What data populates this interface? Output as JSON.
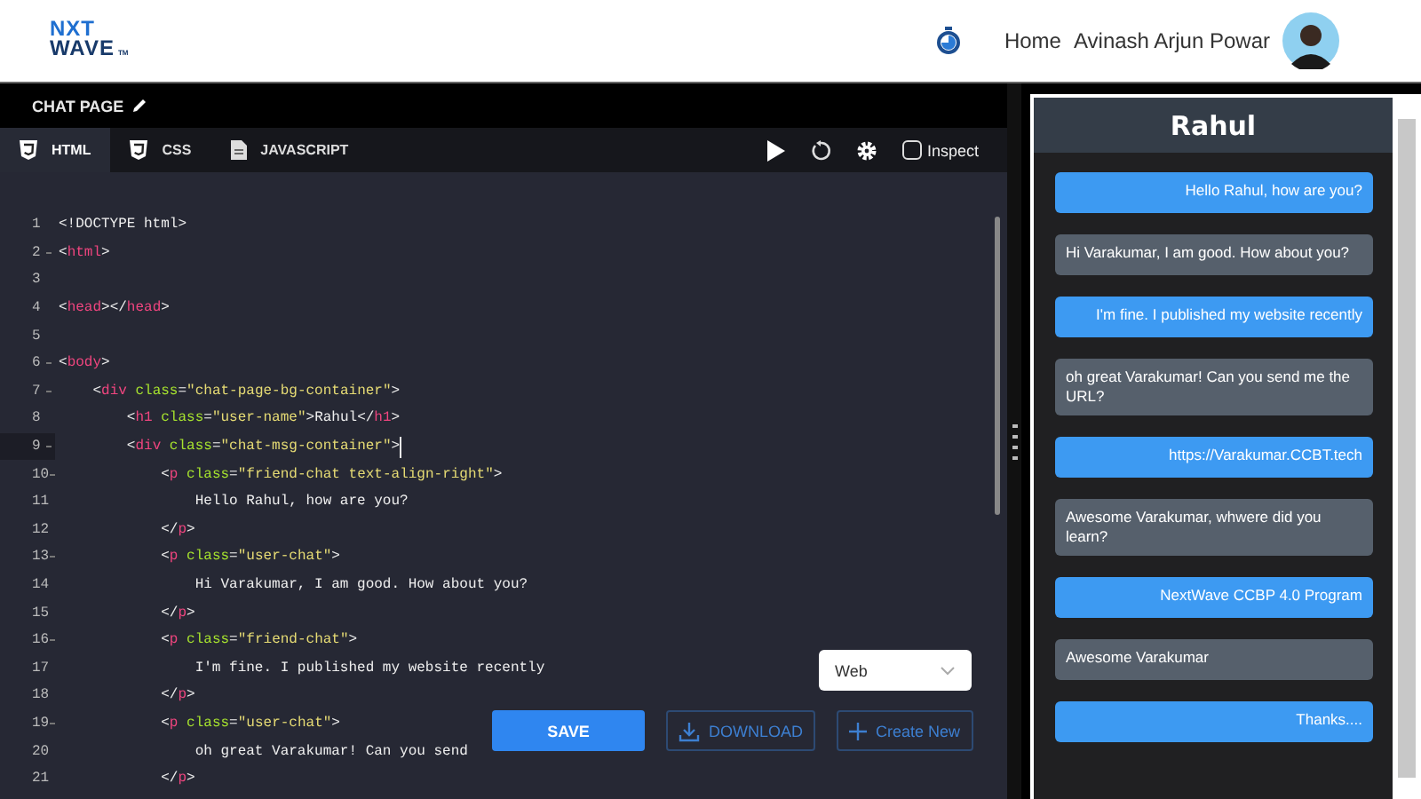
{
  "header": {
    "logo": {
      "line_1": "NXT",
      "line_2": "WAVE",
      "mark": "TM"
    },
    "nav": [
      {
        "label": "Home"
      }
    ],
    "user_name": "Avinash Arjun Powar"
  },
  "project": {
    "title": "CHAT PAGE"
  },
  "tabs": [
    {
      "label": "HTML",
      "kind": "html",
      "selected": true
    },
    {
      "label": "CSS",
      "kind": "css",
      "selected": false
    },
    {
      "label": "JAVASCRIPT",
      "kind": "js",
      "selected": false
    }
  ],
  "toolbar": {
    "inspect": {
      "label": "Inspect",
      "checked": false
    }
  },
  "editor": {
    "lines": [
      {
        "number": "1",
        "foldable": false,
        "active": false,
        "segments": [
          {
            "kind": "punct",
            "text": "<!DOCTYPE html>"
          }
        ]
      },
      {
        "number": "2",
        "foldable": true,
        "active": false,
        "segments": [
          {
            "kind": "punct",
            "text": "<"
          },
          {
            "kind": "tag",
            "text": "html"
          },
          {
            "kind": "punct",
            "text": ">"
          }
        ]
      },
      {
        "number": "3",
        "foldable": false,
        "active": false
      },
      {
        "number": "4",
        "foldable": false,
        "active": false,
        "segments": [
          {
            "kind": "punct",
            "text": "<"
          },
          {
            "kind": "tag",
            "text": "head"
          },
          {
            "kind": "punct",
            "text": "></"
          },
          {
            "kind": "tag",
            "text": "head"
          },
          {
            "kind": "punct",
            "text": ">"
          }
        ]
      },
      {
        "number": "5",
        "foldable": false,
        "active": false
      },
      {
        "number": "6",
        "foldable": true,
        "active": false,
        "segments": [
          {
            "kind": "punct",
            "text": "<"
          },
          {
            "kind": "tag",
            "text": "body"
          },
          {
            "kind": "punct",
            "text": ">"
          }
        ]
      },
      {
        "number": "7",
        "foldable": true,
        "active": false,
        "segments": [
          {
            "kind": "punct",
            "text": "    <"
          },
          {
            "kind": "tag",
            "text": "div"
          },
          {
            "kind": "attr",
            "text": " class"
          },
          {
            "kind": "punct",
            "text": "="
          },
          {
            "kind": "string",
            "text": "\"chat-page-bg-container\""
          },
          {
            "kind": "punct",
            "text": ">"
          }
        ]
      },
      {
        "number": "8",
        "foldable": false,
        "active": false,
        "segments": [
          {
            "kind": "punct",
            "text": "        <"
          },
          {
            "kind": "tag",
            "text": "h1"
          },
          {
            "kind": "attr",
            "text": " class"
          },
          {
            "kind": "punct",
            "text": "="
          },
          {
            "kind": "string",
            "text": "\"user-name\""
          },
          {
            "kind": "punct",
            "text": ">Rahul</"
          },
          {
            "kind": "tag",
            "text": "h1"
          },
          {
            "kind": "punct",
            "text": ">"
          }
        ]
      },
      {
        "number": "9",
        "foldable": true,
        "active": true,
        "segments": [
          {
            "kind": "punct",
            "text": "        <"
          },
          {
            "kind": "tag",
            "text": "div"
          },
          {
            "kind": "attr",
            "text": " class"
          },
          {
            "kind": "punct",
            "text": "="
          },
          {
            "kind": "string",
            "text": "\"chat-msg-container\""
          },
          {
            "kind": "punct",
            "text": ">"
          }
        ]
      },
      {
        "number": "10",
        "foldable": true,
        "active": false,
        "segments": [
          {
            "kind": "punct",
            "text": "            <"
          },
          {
            "kind": "tag",
            "text": "p"
          },
          {
            "kind": "attr",
            "text": " class"
          },
          {
            "kind": "punct",
            "text": "="
          },
          {
            "kind": "string",
            "text": "\"friend-chat text-align-right\""
          },
          {
            "kind": "punct",
            "text": ">"
          }
        ]
      },
      {
        "number": "11",
        "foldable": false,
        "active": false,
        "segments": [
          {
            "kind": "punct",
            "text": "                Hello Rahul, how are you?"
          }
        ]
      },
      {
        "number": "12",
        "foldable": false,
        "active": false,
        "segments": [
          {
            "kind": "punct",
            "text": "            </"
          },
          {
            "kind": "tag",
            "text": "p"
          },
          {
            "kind": "punct",
            "text": ">"
          }
        ]
      },
      {
        "number": "13",
        "foldable": true,
        "active": false,
        "segments": [
          {
            "kind": "punct",
            "text": "            <"
          },
          {
            "kind": "tag",
            "text": "p"
          },
          {
            "kind": "attr",
            "text": " class"
          },
          {
            "kind": "punct",
            "text": "="
          },
          {
            "kind": "string",
            "text": "\"user-chat\""
          },
          {
            "kind": "punct",
            "text": ">"
          }
        ]
      },
      {
        "number": "14",
        "foldable": false,
        "active": false,
        "segments": [
          {
            "kind": "punct",
            "text": "                Hi Varakumar, I am good. How about you?"
          }
        ]
      },
      {
        "number": "15",
        "foldable": false,
        "active": false,
        "segments": [
          {
            "kind": "punct",
            "text": "            </"
          },
          {
            "kind": "tag",
            "text": "p"
          },
          {
            "kind": "punct",
            "text": ">"
          }
        ]
      },
      {
        "number": "16",
        "foldable": true,
        "active": false,
        "segments": [
          {
            "kind": "punct",
            "text": "            <"
          },
          {
            "kind": "tag",
            "text": "p"
          },
          {
            "kind": "attr",
            "text": " class"
          },
          {
            "kind": "punct",
            "text": "="
          },
          {
            "kind": "string",
            "text": "\"friend-chat\""
          },
          {
            "kind": "punct",
            "text": ">"
          }
        ]
      },
      {
        "number": "17",
        "foldable": false,
        "active": false,
        "segments": [
          {
            "kind": "punct",
            "text": "                I'm fine. I published my website recently"
          }
        ]
      },
      {
        "number": "18",
        "foldable": false,
        "active": false,
        "segments": [
          {
            "kind": "punct",
            "text": "            </"
          },
          {
            "kind": "tag",
            "text": "p"
          },
          {
            "kind": "punct",
            "text": ">"
          }
        ]
      },
      {
        "number": "19",
        "foldable": true,
        "active": false,
        "segments": [
          {
            "kind": "punct",
            "text": "            <"
          },
          {
            "kind": "tag",
            "text": "p"
          },
          {
            "kind": "attr",
            "text": " class"
          },
          {
            "kind": "punct",
            "text": "="
          },
          {
            "kind": "string",
            "text": "\"user-chat\""
          },
          {
            "kind": "punct",
            "text": ">"
          }
        ]
      },
      {
        "number": "20",
        "foldable": false,
        "active": false,
        "segments": [
          {
            "kind": "punct",
            "text": "                oh great Varakumar! Can you send"
          }
        ]
      },
      {
        "number": "21",
        "foldable": false,
        "active": false,
        "segments": [
          {
            "kind": "punct",
            "text": "            </"
          },
          {
            "kind": "tag",
            "text": "p"
          },
          {
            "kind": "punct",
            "text": ">"
          }
        ]
      }
    ]
  },
  "platform_select": {
    "value": "Web"
  },
  "actions": {
    "save": "SAVE",
    "download": "DOWNLOAD",
    "create": "Create New"
  },
  "preview": {
    "title": "Rahul",
    "messages": [
      {
        "kind": "friend",
        "text": "Hello Rahul, how are you?"
      },
      {
        "kind": "user",
        "text": "Hi Varakumar, I am good. How about you?"
      },
      {
        "kind": "friend",
        "text": "I'm fine. I published my website recently"
      },
      {
        "kind": "user",
        "text": "oh great Varakumar! Can you send me the URL?"
      },
      {
        "kind": "friend",
        "text": "https://Varakumar.CCBT.tech"
      },
      {
        "kind": "user",
        "text": "Awesome Varakumar, whwere did you learn?"
      },
      {
        "kind": "friend",
        "text": "NextWave CCBP 4.0 Program"
      },
      {
        "kind": "user",
        "text": "Awesome Varakumar"
      },
      {
        "kind": "friend",
        "text": "Thanks...."
      }
    ]
  }
}
